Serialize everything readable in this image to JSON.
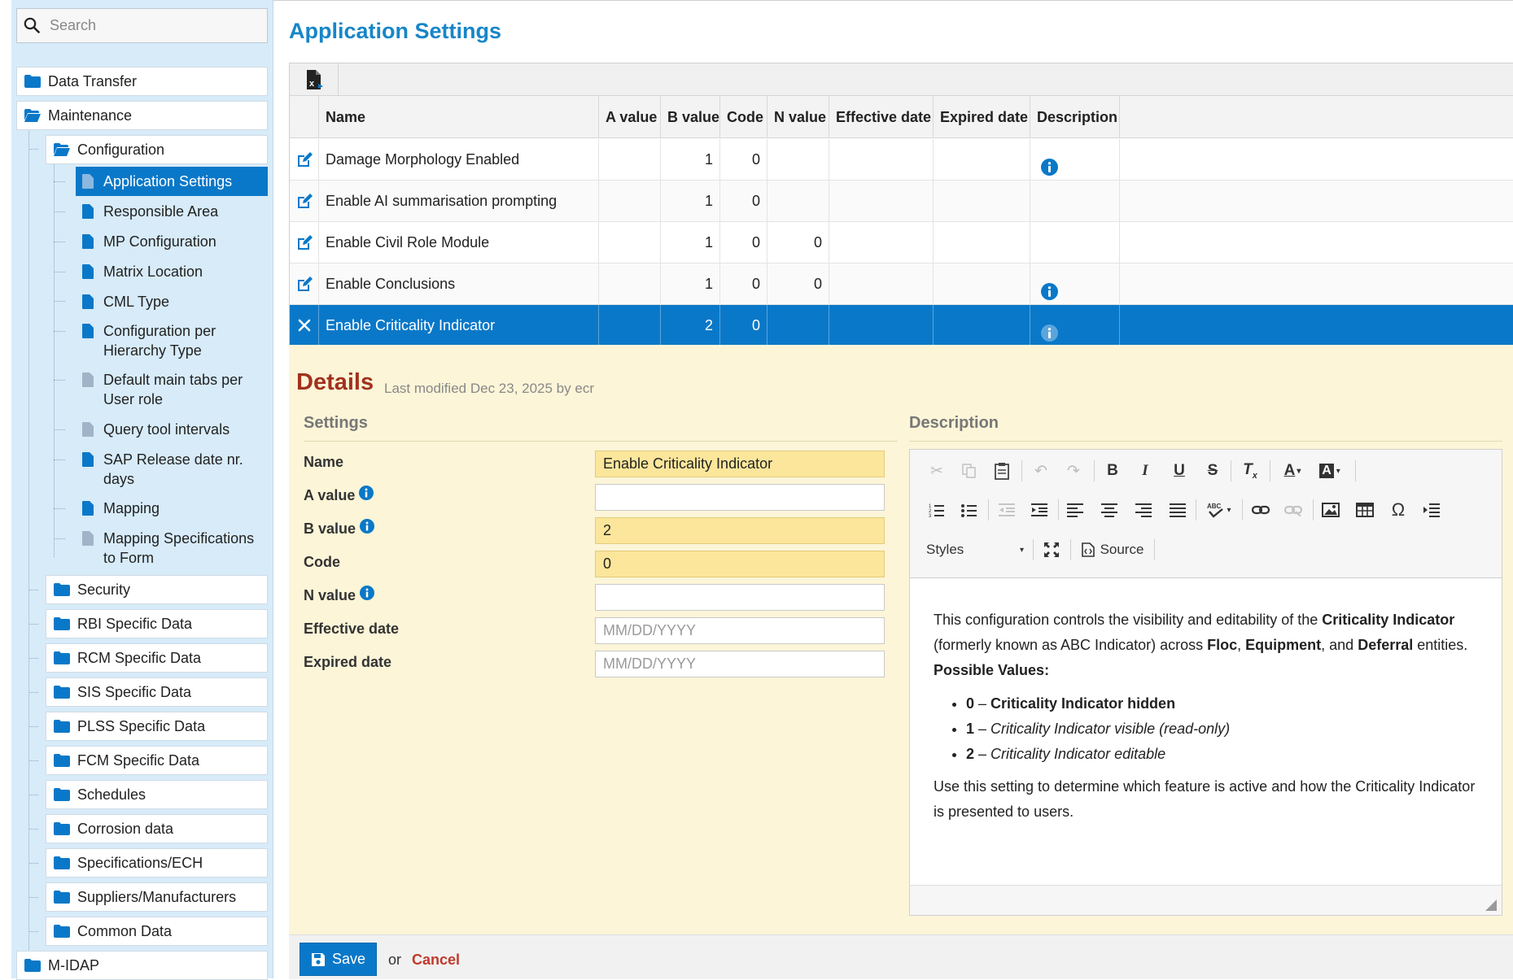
{
  "search": {
    "placeholder": "Search"
  },
  "sidebar": {
    "top": [
      {
        "label": "Data Transfer"
      },
      {
        "label": "Maintenance"
      }
    ],
    "configuration": {
      "label": "Configuration"
    },
    "config_children": [
      {
        "label": "Application Settings"
      },
      {
        "label": "Responsible Area"
      },
      {
        "label": "MP Configuration"
      },
      {
        "label": "Matrix Location"
      },
      {
        "label": "CML Type"
      },
      {
        "label": "Configuration per Hierarchy Type"
      },
      {
        "label": "Default main tabs per User role"
      },
      {
        "label": "Query tool intervals"
      },
      {
        "label": "SAP Release date nr. days"
      },
      {
        "label": "Mapping"
      },
      {
        "label": "Mapping Specifications to Form"
      }
    ],
    "maintenance_children": [
      {
        "label": "Security"
      },
      {
        "label": "RBI Specific Data"
      },
      {
        "label": "RCM Specific Data"
      },
      {
        "label": "SIS Specific Data"
      },
      {
        "label": "PLSS Specific Data"
      },
      {
        "label": "FCM Specific Data"
      },
      {
        "label": "Schedules"
      },
      {
        "label": "Corrosion data"
      },
      {
        "label": "Specifications/ECH"
      },
      {
        "label": "Suppliers/Manufacturers"
      },
      {
        "label": "Common Data"
      }
    ],
    "bottom": [
      {
        "label": "M-IDAP"
      }
    ]
  },
  "page": {
    "title": "Application Settings"
  },
  "grid": {
    "columns": [
      "Name",
      "A value",
      "B value",
      "Code",
      "N value",
      "Effective date",
      "Expired date",
      "Description"
    ],
    "rows": [
      {
        "name": "Damage Morphology Enabled",
        "a": "",
        "b": "1",
        "code": "0",
        "n": "",
        "eff": "",
        "exp": "",
        "has_info": true
      },
      {
        "name": "Enable AI summarisation prompting",
        "a": "",
        "b": "1",
        "code": "0",
        "n": "",
        "eff": "",
        "exp": "",
        "has_info": false
      },
      {
        "name": "Enable Civil Role Module",
        "a": "",
        "b": "1",
        "code": "0",
        "n": "0",
        "eff": "",
        "exp": "",
        "has_info": false
      },
      {
        "name": "Enable Conclusions",
        "a": "",
        "b": "1",
        "code": "0",
        "n": "0",
        "eff": "",
        "exp": "",
        "has_info": true
      },
      {
        "name": "Enable Criticality Indicator",
        "a": "",
        "b": "2",
        "code": "0",
        "n": "",
        "eff": "",
        "exp": "",
        "has_info": true,
        "selected": true
      }
    ]
  },
  "details": {
    "title": "Details",
    "meta": "Last modified Dec 23, 2025 by ecr",
    "settings_heading": "Settings",
    "description_heading": "Description",
    "fields": {
      "name": {
        "label": "Name",
        "value": "Enable Criticality Indicator"
      },
      "a_value": {
        "label": "A value",
        "value": ""
      },
      "b_value": {
        "label": "B value",
        "value": "2"
      },
      "code": {
        "label": "Code",
        "value": "0"
      },
      "n_value": {
        "label": "N value",
        "value": ""
      },
      "effective_date": {
        "label": "Effective date",
        "value": "",
        "placeholder": "MM/DD/YYYY"
      },
      "expired_date": {
        "label": "Expired date",
        "value": "",
        "placeholder": "MM/DD/YYYY"
      }
    },
    "editor": {
      "styles_label": "Styles",
      "source_label": "Source",
      "p1_a": "This configuration controls the visibility and editability of the ",
      "p1_b": "Criticality Indicator",
      "p1_c": " (formerly known as ABC Indicator) across ",
      "p1_d": "Floc",
      "p1_e": ", ",
      "p1_f": "Equipment",
      "p1_g": ", and ",
      "p1_h": "Deferral",
      "p1_i": " entities.",
      "possible": "Possible Values:",
      "li1_num": "0",
      "li1_sep": " – ",
      "li1_text": "Criticality Indicator hidden",
      "li2_num": "1",
      "li2_sep": " – ",
      "li2_text": "Criticality Indicator visible (read-only)",
      "li3_num": "2",
      "li3_sep": " – ",
      "li3_text": "Criticality Indicator editable",
      "p2": "Use this setting to determine which feature is active and how the Criticality Indicator is presented to users."
    }
  },
  "footer": {
    "save_label": "Save",
    "or_text": "or",
    "cancel_label": "Cancel"
  },
  "colors": {
    "accent": "#0a78c8",
    "title": "#1786c8",
    "details_title": "#a1321e",
    "highlight_field": "#fbe69b",
    "cancel": "#c0392b"
  },
  "icons": {
    "search": "search-icon",
    "folder": "folder-icon",
    "folder_open": "folder-open-icon",
    "document": "document-icon",
    "edit": "edit-icon",
    "close": "close-icon",
    "info": "info-icon",
    "export_excel": "excel-export-icon",
    "save": "save-icon"
  }
}
